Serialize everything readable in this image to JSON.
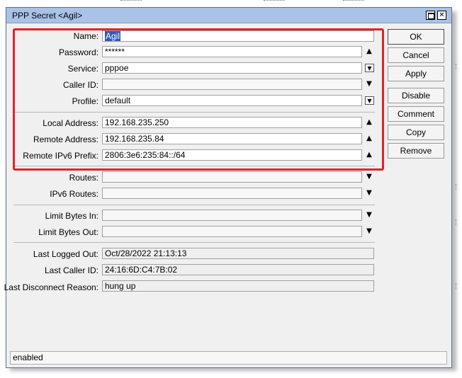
{
  "window": {
    "title": "PPP Secret <Agil>"
  },
  "form": {
    "name": {
      "label": "Name:",
      "value": "Agil"
    },
    "password": {
      "label": "Password:",
      "value": "******"
    },
    "service": {
      "label": "Service:",
      "value": "pppoe"
    },
    "caller_id": {
      "label": "Caller ID:",
      "value": ""
    },
    "profile": {
      "label": "Profile:",
      "value": "default"
    },
    "local_address": {
      "label": "Local Address:",
      "value": "192.168.235.250"
    },
    "remote_address": {
      "label": "Remote Address:",
      "value": "192.168.235.84"
    },
    "remote_ipv6_prefix": {
      "label": "Remote IPv6 Prefix:",
      "value": "2806:3e6:235:84::/64"
    },
    "routes": {
      "label": "Routes:",
      "value": ""
    },
    "ipv6_routes": {
      "label": "IPv6 Routes:",
      "value": ""
    },
    "limit_bytes_in": {
      "label": "Limit Bytes In:",
      "value": ""
    },
    "limit_bytes_out": {
      "label": "Limit Bytes Out:",
      "value": ""
    },
    "last_logged_out": {
      "label": "Last Logged Out:",
      "value": "Oct/28/2022 21:13:13"
    },
    "last_caller_id": {
      "label": "Last Caller ID:",
      "value": "24:16:6D:C4:7B:02"
    },
    "last_disconnect_reason": {
      "label": "Last Disconnect Reason:",
      "value": "hung up"
    }
  },
  "buttons": {
    "ok": "OK",
    "cancel": "Cancel",
    "apply": "Apply",
    "disable": "Disable",
    "comment": "Comment",
    "copy": "Copy",
    "remove": "Remove"
  },
  "status": {
    "text": "enabled"
  },
  "colors": {
    "titlebar": "#a9c2e6",
    "highlight_border": "#e0232b",
    "selection": "#2f5bb3"
  },
  "icons": {
    "expand": "triangle-up-icon",
    "dropdown": "boxed-triangle-down-icon",
    "collapse": "triangle-down-icon"
  }
}
